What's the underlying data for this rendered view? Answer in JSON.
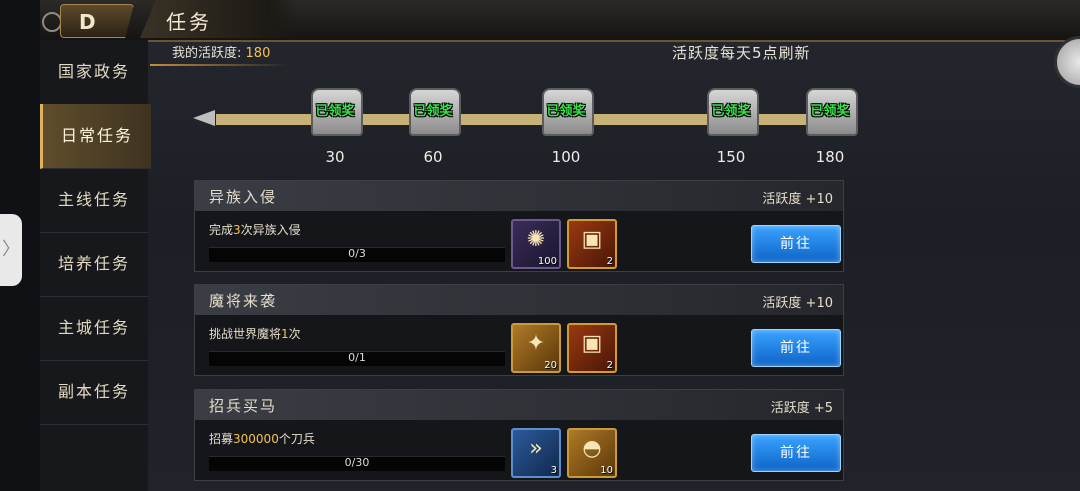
{
  "header": {
    "title": "任务",
    "back_icon": "D"
  },
  "sidebar": {
    "items": [
      {
        "label": "国家政务",
        "active": false
      },
      {
        "label": "日常任务",
        "active": true
      },
      {
        "label": "主线任务",
        "active": false
      },
      {
        "label": "培养任务",
        "active": false
      },
      {
        "label": "主城任务",
        "active": false
      },
      {
        "label": "副本任务",
        "active": false
      }
    ]
  },
  "activity": {
    "label": "我的活跃度:",
    "value": "180",
    "refresh_note": "活跃度每天5点刷新",
    "milestones": [
      {
        "points": "30",
        "status": "已领奖"
      },
      {
        "points": "60",
        "status": "已领奖"
      },
      {
        "points": "100",
        "status": "已领奖"
      },
      {
        "points": "150",
        "status": "已领奖"
      },
      {
        "points": "180",
        "status": "已领奖"
      }
    ]
  },
  "quests": [
    {
      "title": "异族入侵",
      "points": "活跃度 +10",
      "desc_prefix": "完成",
      "desc_highlight": "3",
      "desc_suffix": "次异族入侵",
      "progress": "0/3",
      "rewards": [
        {
          "icon": "rune-stone-icon",
          "qty": "100",
          "style": "purple"
        },
        {
          "icon": "treasure-chest-icon",
          "qty": "2",
          "style": "gold"
        }
      ],
      "button": "前往"
    },
    {
      "title": "魔将来袭",
      "points": "活跃度 +10",
      "desc_prefix": "挑战世界魔将",
      "desc_highlight": "1",
      "desc_suffix": "次",
      "progress": "0/1",
      "rewards": [
        {
          "icon": "crystal-icon",
          "qty": "20",
          "style": "orange"
        },
        {
          "icon": "treasure-chest-icon",
          "qty": "2",
          "style": "gold"
        }
      ],
      "button": "前往"
    },
    {
      "title": "招兵买马",
      "points": "活跃度 +5",
      "desc_prefix": "招募",
      "desc_highlight": "300000",
      "desc_suffix": "个刀兵",
      "progress": "0/30",
      "rewards": [
        {
          "icon": "speed-up-icon",
          "qty": "3",
          "style": "blue"
        },
        {
          "icon": "gold-ingot-icon",
          "qty": "10",
          "style": "orange"
        }
      ],
      "button": "前往"
    }
  ],
  "collapse_icon": "《"
}
